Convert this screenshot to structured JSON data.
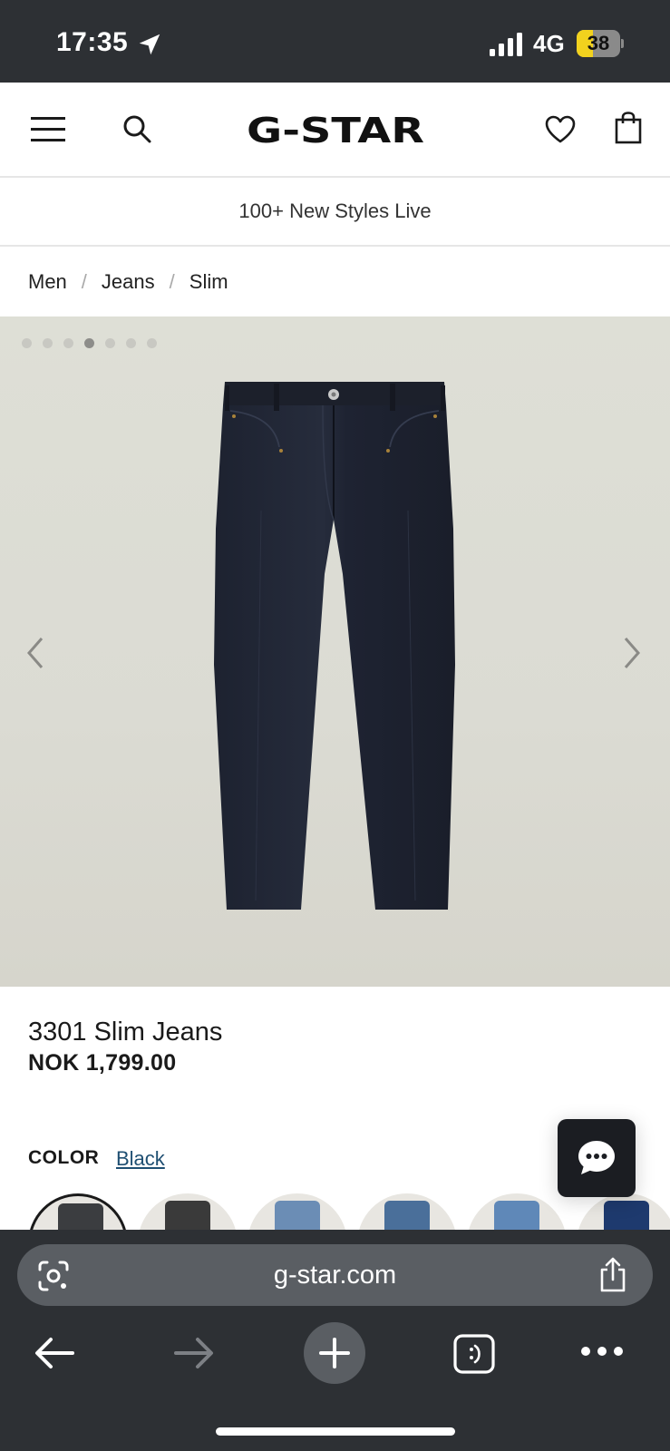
{
  "status_bar": {
    "time": "17:35",
    "network": "4G",
    "battery": "38",
    "battery_level_percent": 38,
    "icons": [
      "location-arrow-icon",
      "signal-bars-icon",
      "battery-icon"
    ]
  },
  "header": {
    "logo_text": "G-STAR",
    "icons": [
      "menu-icon",
      "search-icon",
      "heart-icon",
      "shopping-bag-icon"
    ]
  },
  "promo": {
    "text": "100+ New Styles Live"
  },
  "breadcrumb": {
    "items": [
      "Men",
      "Jeans",
      "Slim"
    ],
    "separator": "/"
  },
  "gallery": {
    "image_count": 7,
    "active_index": 3,
    "icons": [
      "chevron-left-icon",
      "chevron-right-icon"
    ]
  },
  "product": {
    "title": "3301 Slim Jeans",
    "price": "NOK 1,799.00",
    "color_label": "COLOR",
    "color_value": "Black",
    "swatch_count": 6,
    "selected_swatch": 0
  },
  "browser": {
    "url": "g-star.com",
    "icons": [
      "lens-icon",
      "share-icon",
      "back-arrow-icon",
      "forward-arrow-icon",
      "plus-icon",
      "tabs-icon",
      "more-icon"
    ]
  },
  "colors": {
    "status_bar_bg": "#2d3034",
    "battery_fill": "#f2d21e",
    "gallery_bg": "#dcdcd4",
    "link": "#1f4f72",
    "chat_bg": "#1b1d22"
  }
}
